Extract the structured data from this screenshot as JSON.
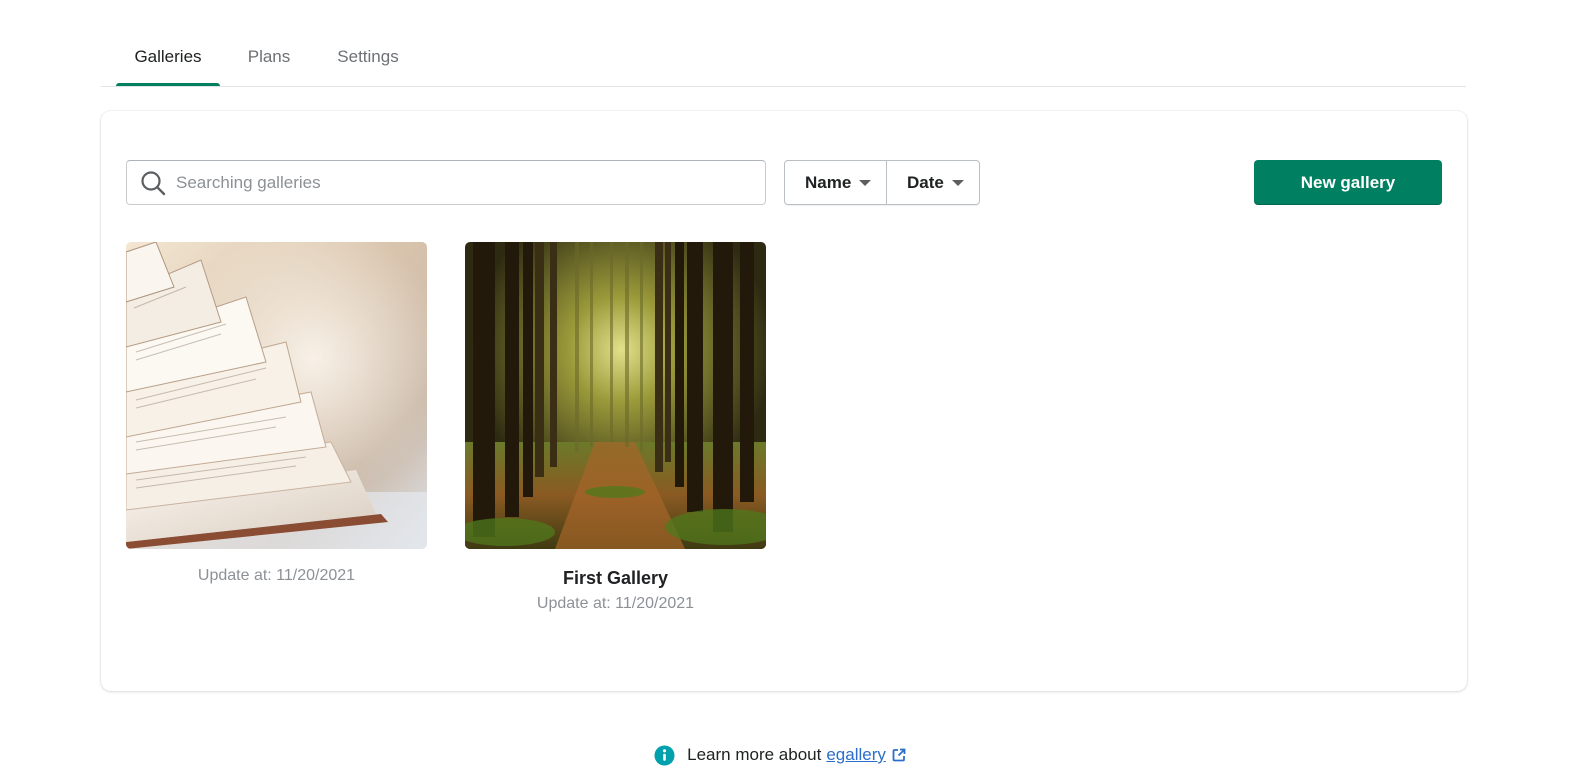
{
  "tabs": [
    {
      "label": "Galleries",
      "active": true
    },
    {
      "label": "Plans",
      "active": false
    },
    {
      "label": "Settings",
      "active": false
    }
  ],
  "toolbar": {
    "search_placeholder": "Searching galleries",
    "search_value": "",
    "sort_name_label": "Name",
    "sort_date_label": "Date",
    "new_gallery_label": "New gallery"
  },
  "galleries": [
    {
      "title": "",
      "updated": "Update at: 11/20/2021",
      "image": "open-book-photo"
    },
    {
      "title": "First Gallery",
      "updated": "Update at: 11/20/2021",
      "image": "forest-path-photo"
    }
  ],
  "footer": {
    "text": "Learn more about",
    "link_label": "egallery",
    "icon": "info-icon"
  },
  "colors": {
    "accent": "#008060",
    "link": "#2c6ecb",
    "info": "#00a0ac",
    "muted": "#8c9196"
  }
}
